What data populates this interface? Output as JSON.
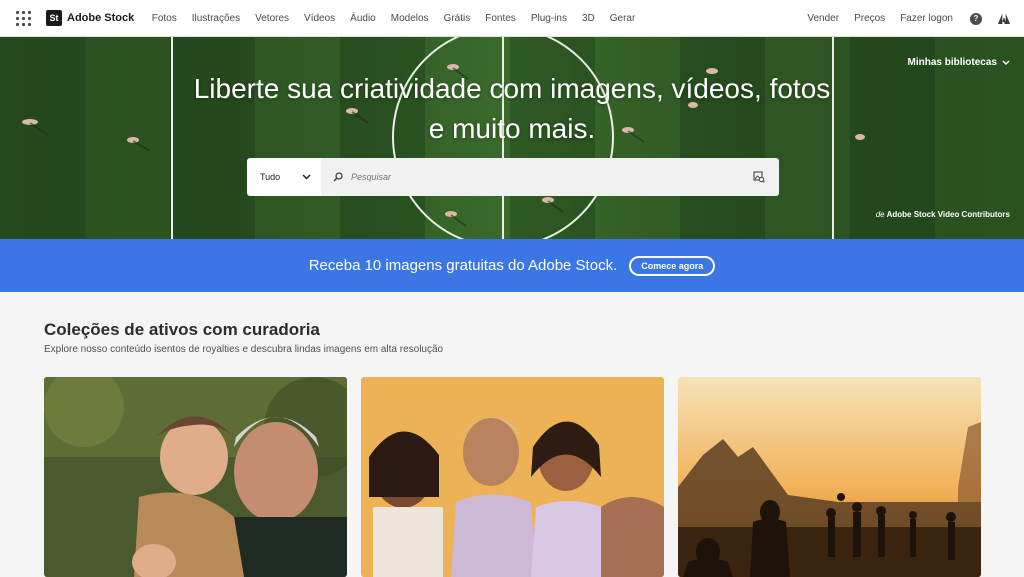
{
  "nav": {
    "brand_mark": "St",
    "brand_name": "Adobe Stock",
    "links": [
      "Fotos",
      "Ilustrações",
      "Vetores",
      "Vídeos",
      "Áudio",
      "Modelos",
      "Grátis",
      "Fontes",
      "Plug-ins",
      "3D",
      "Gerar"
    ],
    "right_links": [
      "Vender",
      "Preços",
      "Fazer logon"
    ],
    "help_glyph": "?"
  },
  "hero": {
    "headline_line1": "Liberte sua criatividade com imagens, vídeos, fotos",
    "headline_line2": "e muito mais.",
    "libraries_label": "Minhas bibliotecas",
    "credit_prefix": "de",
    "credit_name": "Adobe Stock Video Contributors"
  },
  "search": {
    "category_value": "Tudo",
    "placeholder": "Pesquisar"
  },
  "promo": {
    "text": "Receba 10 imagens gratuitas do Adobe Stock.",
    "button_label": "Comece agora"
  },
  "collections": {
    "title": "Coleções de ativos com curadoria",
    "subtitle": "Explore nosso conteúdo isentos de royalties e descubra lindas imagens em alta resolução"
  },
  "colors": {
    "promo_blue": "#3b76e5",
    "field_green": "#2f5e27",
    "nav_text": "#4b4b4b"
  },
  "icons": [
    "app-grid-icon",
    "chevron-down-icon",
    "search-icon",
    "visual-search-icon",
    "help-icon",
    "adobe-icon"
  ]
}
